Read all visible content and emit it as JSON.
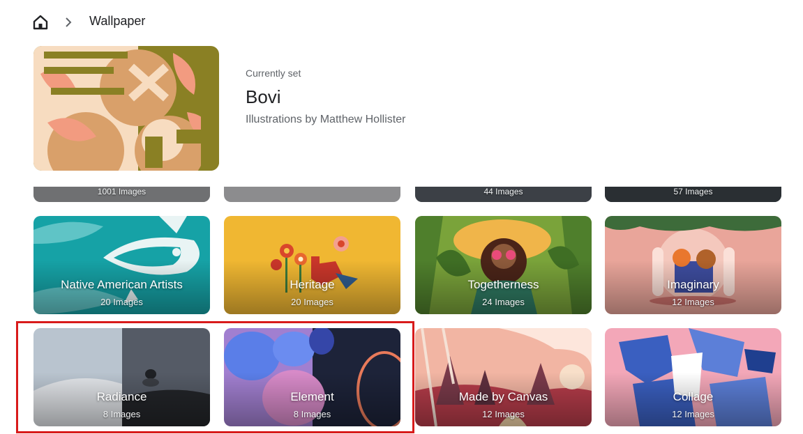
{
  "breadcrumb": {
    "home_icon": "home-icon",
    "separator_icon": "chevron-right-icon",
    "title": "Wallpaper"
  },
  "current": {
    "label": "Currently set",
    "name": "Bovi",
    "author": "Illustrations by Matthew Hollister"
  },
  "partial_row": [
    {
      "count": "1001 Images"
    },
    {
      "count": ""
    },
    {
      "count": "44 Images"
    },
    {
      "count": "57 Images"
    }
  ],
  "collections": [
    {
      "name": "Native American Artists",
      "count": "20 Images"
    },
    {
      "name": "Heritage",
      "count": "20 Images"
    },
    {
      "name": "Togetherness",
      "count": "24 Images"
    },
    {
      "name": "Imaginary",
      "count": "12 Images"
    },
    {
      "name": "Radiance",
      "count": "8 Images"
    },
    {
      "name": "Element",
      "count": "8 Images"
    },
    {
      "name": "Made by Canvas",
      "count": "12 Images"
    },
    {
      "name": "Collage",
      "count": "12 Images"
    }
  ],
  "colors": {
    "highlight": "#d81b1b"
  }
}
